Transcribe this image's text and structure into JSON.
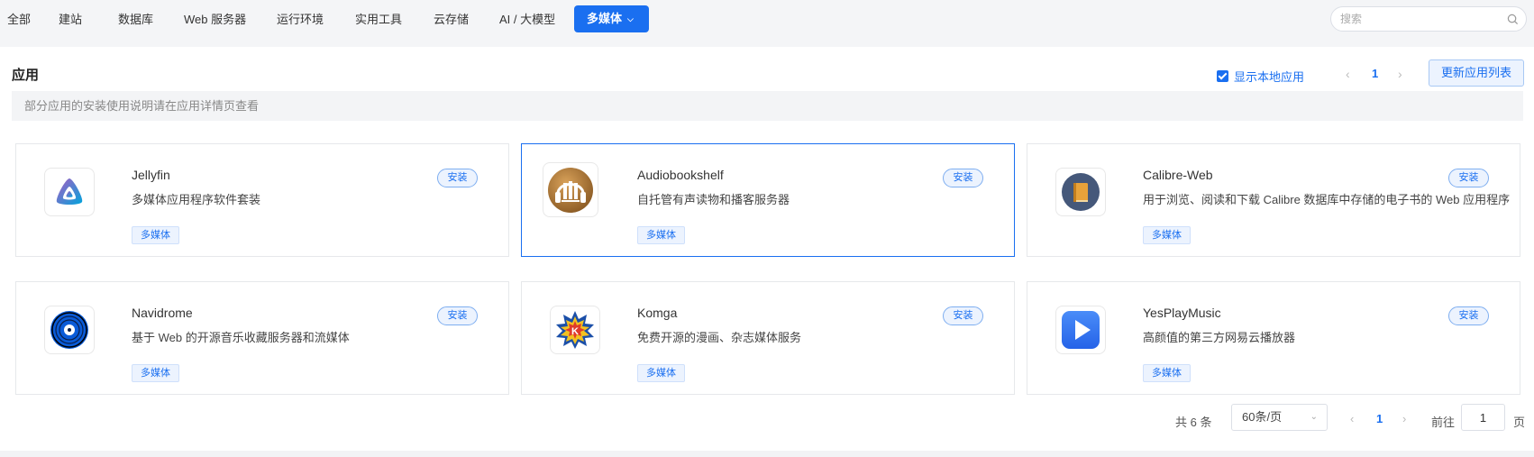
{
  "nav": {
    "tabs": [
      {
        "label": "全部"
      },
      {
        "label": "建站"
      },
      {
        "label": "数据库"
      },
      {
        "label": "Web 服务器"
      },
      {
        "label": "运行环境"
      },
      {
        "label": "实用工具"
      },
      {
        "label": "云存储"
      },
      {
        "label": "AI / 大模型"
      },
      {
        "label": "多媒体",
        "active": true
      }
    ],
    "search_placeholder": "搜索"
  },
  "header": {
    "title": "应用",
    "show_local_label": "显示本地应用",
    "show_local_checked": true,
    "current_page": "1",
    "refresh_label": "更新应用列表"
  },
  "notice": "部分应用的安装使用说明请在应用详情页查看",
  "apps": [
    {
      "name": "Jellyfin",
      "desc": "多媒体应用程序软件套装",
      "tag": "多媒体",
      "install": "安装",
      "icon": "jellyfin-icon"
    },
    {
      "name": "Audiobookshelf",
      "desc": "自托管有声读物和播客服务器",
      "tag": "多媒体",
      "install": "安装",
      "icon": "audiobookshelf-icon"
    },
    {
      "name": "Calibre-Web",
      "desc": "用于浏览、阅读和下载 Calibre 数据库中存储的电子书的 Web 应用程序",
      "tag": "多媒体",
      "install": "安装",
      "icon": "calibre-web-icon"
    },
    {
      "name": "Navidrome",
      "desc": "基于 Web 的开源音乐收藏服务器和流媒体",
      "tag": "多媒体",
      "install": "安装",
      "icon": "navidrome-icon"
    },
    {
      "name": "Komga",
      "desc": "免费开源的漫画、杂志媒体服务",
      "tag": "多媒体",
      "install": "安装",
      "icon": "komga-icon"
    },
    {
      "name": "YesPlayMusic",
      "desc": "高颜值的第三方网易云播放器",
      "tag": "多媒体",
      "install": "安装",
      "icon": "yesplaymusic-icon"
    }
  ],
  "pagination": {
    "total": "共 6 条",
    "page_size": "60条/页",
    "current_page": "1",
    "goto_label": "前往",
    "goto_value": "1",
    "goto_unit": "页"
  },
  "colors": {
    "accent": "#1a6ff0",
    "tag_bg": "#ecf3fe"
  }
}
